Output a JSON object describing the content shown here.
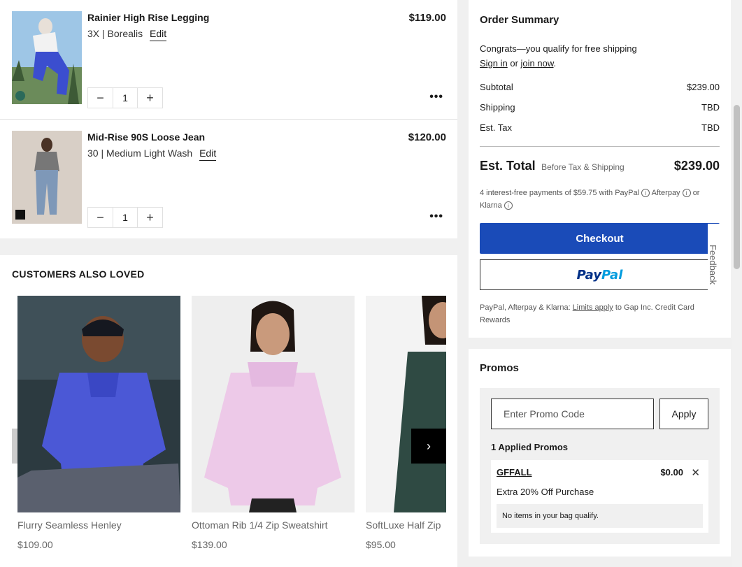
{
  "bag": {
    "items": [
      {
        "name": "Rainier High Rise Legging",
        "meta": "3X | Borealis",
        "edit": "Edit",
        "price": "$119.00",
        "qty": "1",
        "minus": "−",
        "plus": "+",
        "more": "•••"
      },
      {
        "name": "Mid-Rise 90S Loose Jean",
        "meta": "30 | Medium Light Wash",
        "edit": "Edit",
        "price": "$120.00",
        "qty": "1",
        "minus": "−",
        "plus": "+",
        "more": "•••"
      }
    ]
  },
  "reco": {
    "title": "CUSTOMERS ALSO LOVED",
    "next_icon": "chevron-right-icon",
    "next_glyph": "›",
    "products": [
      {
        "name": "Flurry Seamless Henley",
        "price": "$109.00"
      },
      {
        "name": "Ottoman Rib 1/4 Zip Sweatshirt",
        "price": "$139.00"
      },
      {
        "name": "SoftLuxe Half Zip",
        "price": "$95.00"
      }
    ]
  },
  "summary": {
    "title": "Order Summary",
    "congrats": "Congrats—you qualify for free shipping",
    "sign_in": "Sign in",
    "or": " or ",
    "join_now": "join now",
    "period": ".",
    "subtotal_label": "Subtotal",
    "subtotal": "$239.00",
    "shipping_label": "Shipping",
    "shipping": "TBD",
    "tax_label": "Est. Tax",
    "tax": "TBD",
    "total_label": "Est. Total",
    "total_sub": "Before Tax & Shipping",
    "total": "$239.00",
    "paynote_a": "4 interest-free payments of $59.75 with PayPal",
    "paynote_b": "Afterpay",
    "paynote_c": "or",
    "paynote_d": "Klarna",
    "info_glyph": "i",
    "checkout": "Checkout",
    "paypal_a": "Pay",
    "paypal_b": "Pal",
    "limits_a": "PayPal, Afterpay & Klarna: ",
    "limits_link": "Limits apply",
    "limits_b": " to Gap Inc. Credit Card Rewards"
  },
  "feedback": "Feedback",
  "promos": {
    "title": "Promos",
    "placeholder": "Enter Promo Code",
    "apply": "Apply",
    "applied_label": "1 Applied Promos",
    "code": "GFFALL",
    "amount": "$0.00",
    "close": "✕",
    "desc": "Extra 20% Off Purchase",
    "note": "No items in your bag qualify."
  },
  "colors": {
    "checkout": "#1a4bb8",
    "paypal_dark": "#003087",
    "paypal_light": "#009cde"
  }
}
